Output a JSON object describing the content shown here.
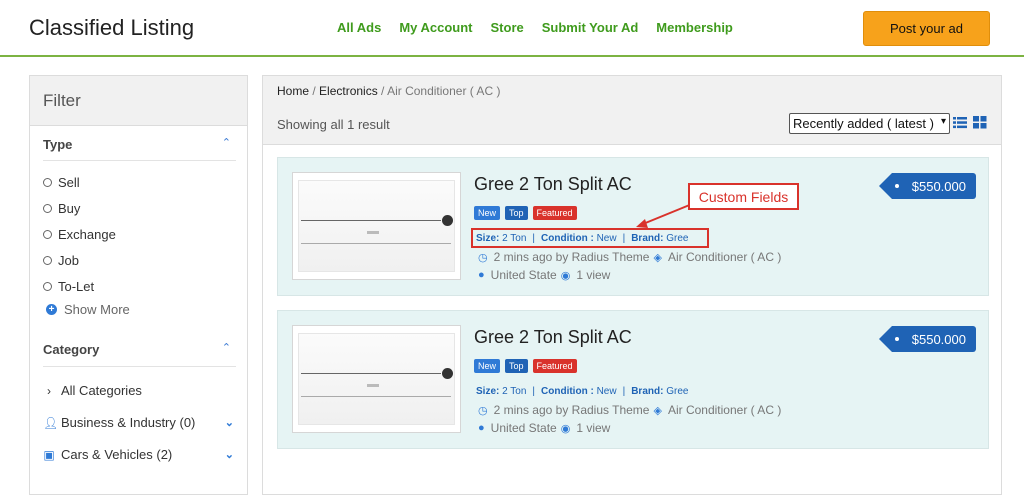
{
  "header": {
    "brand": "Classified Listing",
    "nav": [
      "All Ads",
      "My Account",
      "Store",
      "Submit Your Ad",
      "Membership"
    ],
    "post_button": "Post your ad"
  },
  "sidebar": {
    "title": "Filter",
    "type_title": "Type",
    "type_options": [
      "Sell",
      "Buy",
      "Exchange",
      "Job",
      "To-Let"
    ],
    "show_more": "Show More",
    "category_title": "Category",
    "categories": [
      {
        "label": "All Categories",
        "icon": "chevron-right-icon"
      },
      {
        "label": "Business & Industry (0)",
        "icon": "person-icon"
      },
      {
        "label": "Cars & Vehicles (2)",
        "icon": "car-icon"
      }
    ]
  },
  "content": {
    "breadcrumb": {
      "home": "Home",
      "sep": " / ",
      "section": "Electronics",
      "current": "Air Conditioner ( AC )"
    },
    "result_text": "Showing all 1 result",
    "sort": {
      "selected": "Recently added ( latest )"
    },
    "listings": [
      {
        "title": "Gree 2 Ton Split AC",
        "badges": [
          "New",
          "Top",
          "Featured"
        ],
        "fields": {
          "size_label": "Size:",
          "size": "2 Ton",
          "condition_label": "Condition :",
          "condition": "New",
          "brand_label": "Brand:",
          "brand": "Gree"
        },
        "posted": "2 mins ago by Radius Theme",
        "category": "Air Conditioner ( AC )",
        "location": "United State",
        "views": "1 view",
        "price": "$550.000"
      },
      {
        "title": "Gree 2 Ton Split AC",
        "badges": [
          "New",
          "Top",
          "Featured"
        ],
        "fields": {
          "size_label": "Size:",
          "size": "2 Ton",
          "condition_label": "Condition :",
          "condition": "New",
          "brand_label": "Brand:",
          "brand": "Gree"
        },
        "posted": "2 mins ago by Radius Theme",
        "category": "Air Conditioner ( AC )",
        "location": "United State",
        "views": "1 view",
        "price": "$550.000"
      }
    ]
  },
  "annotation": {
    "callout": "Custom Fields"
  },
  "colors": {
    "accent_green": "#3f9b1d",
    "post_button": "#f7a21b",
    "link_blue": "#1f63b5",
    "featured_red": "#d9322b",
    "card_bg": "#e6f4f4"
  }
}
